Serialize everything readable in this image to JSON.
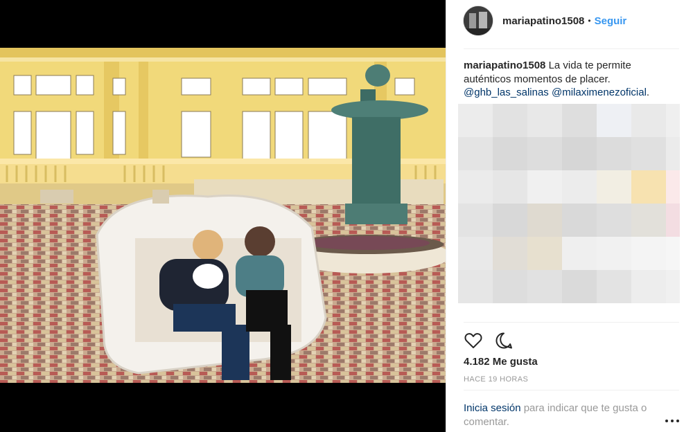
{
  "header": {
    "username": "mariapatino1508",
    "separator": "•",
    "follow_label": "Seguir",
    "avatar_icon": "profile-avatar-icon"
  },
  "caption": {
    "username": "mariapatino1508",
    "text": "La vida te permite auténticos momentos de placer.",
    "mentions": [
      "@ghb_las_salinas",
      "@milaximenezoficial"
    ],
    "trailing": "."
  },
  "actions": {
    "like_icon": "heart-icon",
    "comment_icon": "comment-icon"
  },
  "likes_label": "4.182 Me gusta",
  "timestamp": "HACE 19 HORAS",
  "login_prompt": {
    "link": "Inicia sesión",
    "text": " para indicar que te gusta o comentar."
  },
  "more_icon": "more-options-icon",
  "colors": {
    "link_blue": "#3897f0",
    "mention_blue": "#003569",
    "muted": "#999999",
    "text": "#262626"
  }
}
